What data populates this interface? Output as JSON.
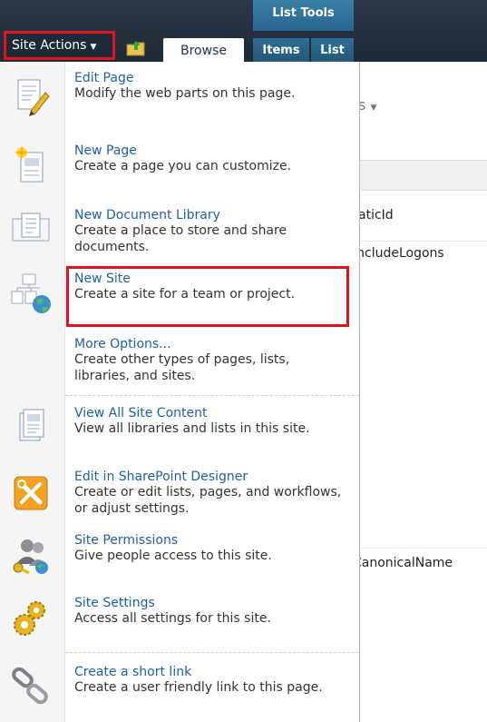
{
  "ribbon": {
    "site_actions_label": "Site Actions",
    "browse_tab": "Browse",
    "list_tools_label": "List Tools",
    "items_tab": "Items",
    "list_tab": "List"
  },
  "background": {
    "header_fragment": "s",
    "col_fragment": "aticId",
    "row1_fragment": "IncludeLogons",
    "row2_fragment": "CanonicalName"
  },
  "menu": {
    "items": [
      {
        "title": "Edit Page",
        "desc": "Modify the web parts on this page.",
        "icon": "edit-page-icon"
      },
      {
        "title": "New Page",
        "desc": "Create a page you can customize.",
        "icon": "new-page-icon"
      },
      {
        "title": "New Document Library",
        "desc": "Create a place to store and share documents.",
        "icon": "document-library-icon"
      },
      {
        "title": "New Site",
        "desc": "Create a site for a team or project.",
        "icon": "new-site-icon"
      },
      {
        "title": "More Options...",
        "desc": "Create other types of pages, lists, libraries, and sites.",
        "icon": ""
      },
      {
        "title": "View All Site Content",
        "desc": "View all libraries and lists in this site.",
        "icon": "site-content-icon"
      },
      {
        "title": "Edit in SharePoint Designer",
        "desc": "Create or edit lists, pages, and workflows, or adjust settings.",
        "icon": "sharepoint-designer-icon"
      },
      {
        "title": "Site Permissions",
        "desc": "Give people access to this site.",
        "icon": "permissions-icon"
      },
      {
        "title": "Site Settings",
        "desc": "Access all settings for this site.",
        "icon": "gears-icon"
      },
      {
        "title": "Create a short link",
        "desc": "Create a user friendly link to this page.",
        "icon": "chain-link-icon"
      }
    ]
  },
  "colors": {
    "ribbon_bg": "#1e2937",
    "highlight": "#e0121d",
    "link_blue": "#1f5fa8"
  }
}
